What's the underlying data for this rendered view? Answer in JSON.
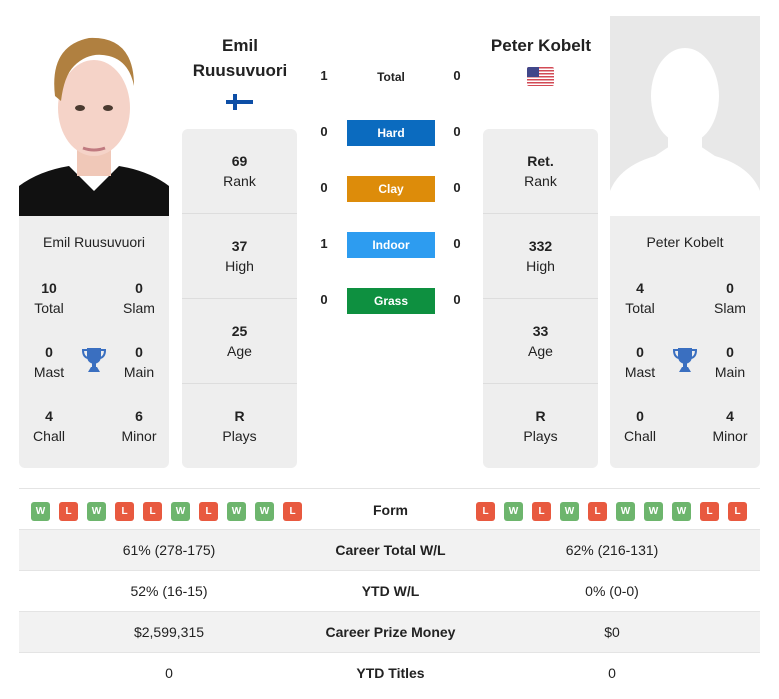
{
  "player1": {
    "name_line1": "Emil",
    "name_line2": "Ruusuvuori",
    "full_name": "Emil Ruusuvuori",
    "country_flag": "finland-flag",
    "titles": {
      "total": {
        "value": "10",
        "label": "Total"
      },
      "slam": {
        "value": "0",
        "label": "Slam"
      },
      "mast": {
        "value": "0",
        "label": "Mast"
      },
      "main": {
        "value": "0",
        "label": "Main"
      },
      "chall": {
        "value": "4",
        "label": "Chall"
      },
      "minor": {
        "value": "6",
        "label": "Minor"
      }
    },
    "profile": [
      {
        "value": "69",
        "label": "Rank"
      },
      {
        "value": "37",
        "label": "High"
      },
      {
        "value": "25",
        "label": "Age"
      },
      {
        "value": "R",
        "label": "Plays"
      }
    ],
    "form": [
      "W",
      "L",
      "W",
      "L",
      "L",
      "W",
      "L",
      "W",
      "W",
      "L"
    ]
  },
  "player2": {
    "name": "Peter Kobelt",
    "full_name": "Peter Kobelt",
    "country_flag": "usa-flag",
    "titles": {
      "total": {
        "value": "4",
        "label": "Total"
      },
      "slam": {
        "value": "0",
        "label": "Slam"
      },
      "mast": {
        "value": "0",
        "label": "Mast"
      },
      "main": {
        "value": "0",
        "label": "Main"
      },
      "chall": {
        "value": "0",
        "label": "Chall"
      },
      "minor": {
        "value": "4",
        "label": "Minor"
      }
    },
    "profile": [
      {
        "value": "Ret.",
        "label": "Rank"
      },
      {
        "value": "332",
        "label": "High"
      },
      {
        "value": "33",
        "label": "Age"
      },
      {
        "value": "R",
        "label": "Plays"
      }
    ],
    "form": [
      "L",
      "W",
      "L",
      "W",
      "L",
      "W",
      "W",
      "W",
      "L",
      "L"
    ]
  },
  "h2h": {
    "total": {
      "label": "Total",
      "p1": "1",
      "p2": "0"
    },
    "surfaces": [
      {
        "label": "Hard",
        "p1": "0",
        "p2": "0",
        "color": "#0b6bbf"
      },
      {
        "label": "Clay",
        "p1": "0",
        "p2": "0",
        "color": "#dd8c0a"
      },
      {
        "label": "Indoor",
        "p1": "1",
        "p2": "0",
        "color": "#2d9cf0"
      },
      {
        "label": "Grass",
        "p1": "0",
        "p2": "0",
        "color": "#0e9040"
      }
    ]
  },
  "stats": {
    "form_label": "Form",
    "rows": [
      {
        "label": "Career Total W/L",
        "p1": "61% (278-175)",
        "p2": "62% (216-131)"
      },
      {
        "label": "YTD W/L",
        "p1": "52% (16-15)",
        "p2": "0% (0-0)"
      },
      {
        "label": "Career Prize Money",
        "p1": "$2,599,315",
        "p2": "$0"
      },
      {
        "label": "YTD Titles",
        "p1": "0",
        "p2": "0"
      }
    ]
  }
}
